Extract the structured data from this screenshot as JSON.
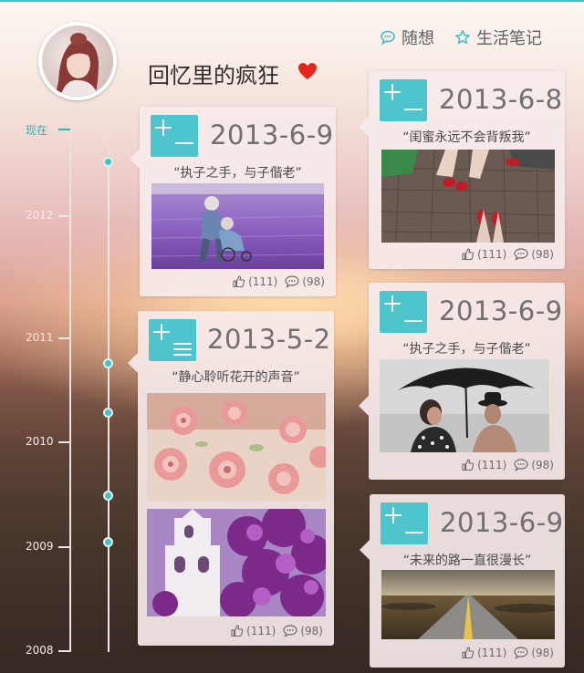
{
  "header": {
    "title": "回忆里的疯狂",
    "nav": [
      {
        "label": "随想",
        "icon": "speech-bubble-icon"
      },
      {
        "label": "生活笔记",
        "icon": "star-icon"
      }
    ]
  },
  "timeline": {
    "current_label": "现在",
    "years": [
      "2012",
      "2011",
      "2010",
      "2009",
      "2008"
    ]
  },
  "posts": [
    {
      "date": "2013-6-9",
      "quote": "“执子之手，与子偕老”",
      "likes": "(111)",
      "comments": "(98)",
      "image": "elderly couple in lavender field"
    },
    {
      "date": "2013-5-2",
      "quote": "“静心聆听花开的声音”",
      "likes": "(111)",
      "comments": "(98)",
      "image": "pink roses; purple flowers with white bell tower"
    },
    {
      "date": "2013-6-8",
      "quote": "“闺蜜永远不会背叛我”",
      "likes": "(111)",
      "comments": "(98)",
      "image": "red shoes on cobblestones"
    },
    {
      "date": "2013-6-9",
      "quote": "“执子之手，与子偕老”",
      "likes": "(111)",
      "comments": "(98)",
      "image": "couple under black umbrella"
    },
    {
      "date": "2013-6-9",
      "quote": "“未来的路一直很漫长”",
      "likes": "(111)",
      "comments": "(98)",
      "image": "long road to horizon"
    }
  ],
  "colors": {
    "accent": "#4ec5cc",
    "heart": "#e3261c"
  }
}
